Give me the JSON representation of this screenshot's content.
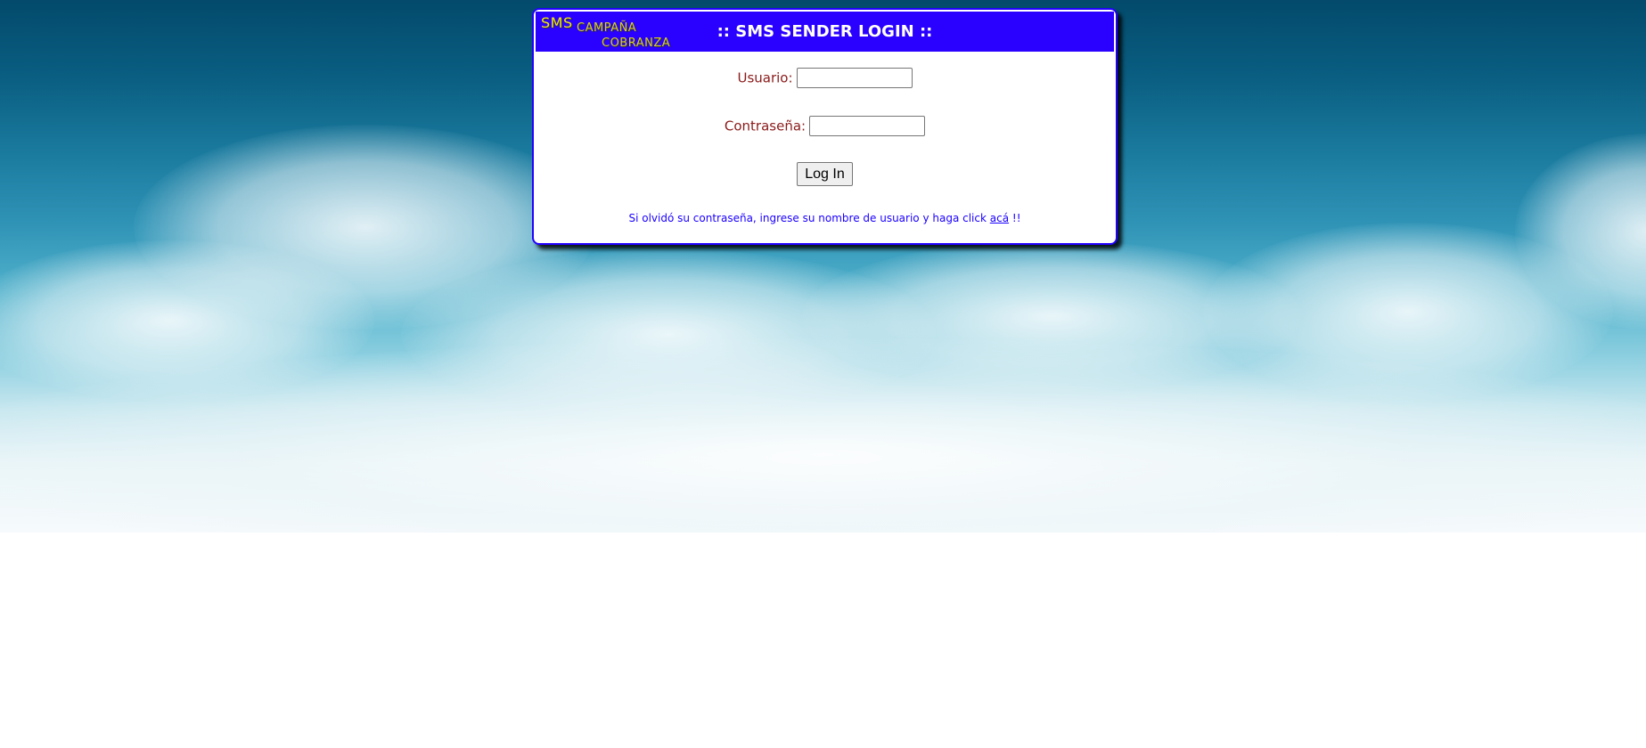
{
  "header": {
    "logo_sms": "SMS",
    "logo_campana": "CAMPAÑA",
    "logo_cobranza": "COBRANZA",
    "title": ":: SMS SENDER LOGIN ::"
  },
  "form": {
    "username_label": "Usuario:",
    "username_value": "",
    "password_label": "Contraseña:",
    "password_value": "",
    "login_button": "Log In"
  },
  "forgot": {
    "text_before": "Si olvidó su contraseña, ingrese su nombre de usuario y haga click",
    "link_text": "acá",
    "text_after": "!!"
  },
  "colors": {
    "header_bg": "#2a00ff",
    "label_color": "#8b1a1a",
    "link_color": "#1a00ff"
  }
}
